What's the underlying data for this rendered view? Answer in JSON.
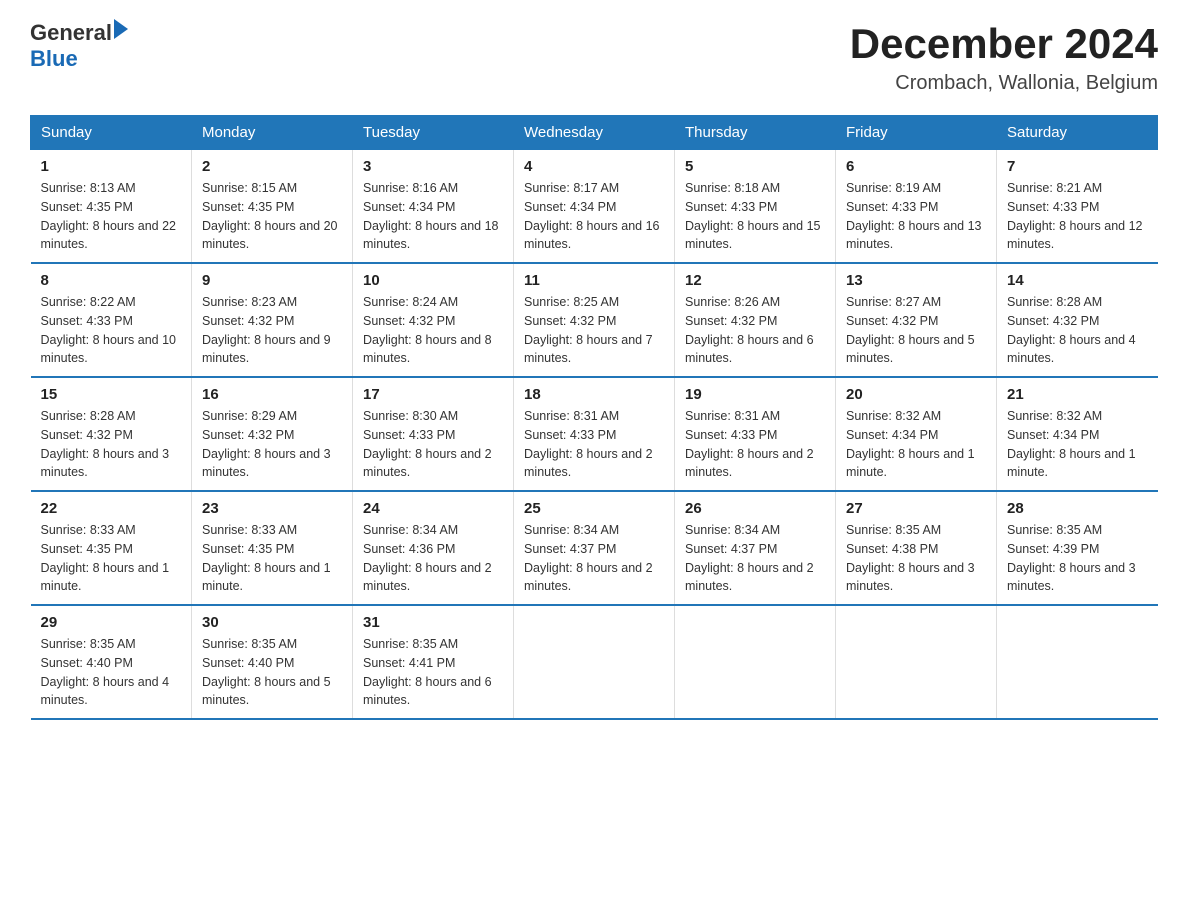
{
  "header": {
    "logo_general": "General",
    "logo_blue": "Blue",
    "title": "December 2024",
    "subtitle": "Crombach, Wallonia, Belgium"
  },
  "days_of_week": [
    "Sunday",
    "Monday",
    "Tuesday",
    "Wednesday",
    "Thursday",
    "Friday",
    "Saturday"
  ],
  "weeks": [
    [
      {
        "day": "1",
        "sunrise": "8:13 AM",
        "sunset": "4:35 PM",
        "daylight": "8 hours and 22 minutes."
      },
      {
        "day": "2",
        "sunrise": "8:15 AM",
        "sunset": "4:35 PM",
        "daylight": "8 hours and 20 minutes."
      },
      {
        "day": "3",
        "sunrise": "8:16 AM",
        "sunset": "4:34 PM",
        "daylight": "8 hours and 18 minutes."
      },
      {
        "day": "4",
        "sunrise": "8:17 AM",
        "sunset": "4:34 PM",
        "daylight": "8 hours and 16 minutes."
      },
      {
        "day": "5",
        "sunrise": "8:18 AM",
        "sunset": "4:33 PM",
        "daylight": "8 hours and 15 minutes."
      },
      {
        "day": "6",
        "sunrise": "8:19 AM",
        "sunset": "4:33 PM",
        "daylight": "8 hours and 13 minutes."
      },
      {
        "day": "7",
        "sunrise": "8:21 AM",
        "sunset": "4:33 PM",
        "daylight": "8 hours and 12 minutes."
      }
    ],
    [
      {
        "day": "8",
        "sunrise": "8:22 AM",
        "sunset": "4:33 PM",
        "daylight": "8 hours and 10 minutes."
      },
      {
        "day": "9",
        "sunrise": "8:23 AM",
        "sunset": "4:32 PM",
        "daylight": "8 hours and 9 minutes."
      },
      {
        "day": "10",
        "sunrise": "8:24 AM",
        "sunset": "4:32 PM",
        "daylight": "8 hours and 8 minutes."
      },
      {
        "day": "11",
        "sunrise": "8:25 AM",
        "sunset": "4:32 PM",
        "daylight": "8 hours and 7 minutes."
      },
      {
        "day": "12",
        "sunrise": "8:26 AM",
        "sunset": "4:32 PM",
        "daylight": "8 hours and 6 minutes."
      },
      {
        "day": "13",
        "sunrise": "8:27 AM",
        "sunset": "4:32 PM",
        "daylight": "8 hours and 5 minutes."
      },
      {
        "day": "14",
        "sunrise": "8:28 AM",
        "sunset": "4:32 PM",
        "daylight": "8 hours and 4 minutes."
      }
    ],
    [
      {
        "day": "15",
        "sunrise": "8:28 AM",
        "sunset": "4:32 PM",
        "daylight": "8 hours and 3 minutes."
      },
      {
        "day": "16",
        "sunrise": "8:29 AM",
        "sunset": "4:32 PM",
        "daylight": "8 hours and 3 minutes."
      },
      {
        "day": "17",
        "sunrise": "8:30 AM",
        "sunset": "4:33 PM",
        "daylight": "8 hours and 2 minutes."
      },
      {
        "day": "18",
        "sunrise": "8:31 AM",
        "sunset": "4:33 PM",
        "daylight": "8 hours and 2 minutes."
      },
      {
        "day": "19",
        "sunrise": "8:31 AM",
        "sunset": "4:33 PM",
        "daylight": "8 hours and 2 minutes."
      },
      {
        "day": "20",
        "sunrise": "8:32 AM",
        "sunset": "4:34 PM",
        "daylight": "8 hours and 1 minute."
      },
      {
        "day": "21",
        "sunrise": "8:32 AM",
        "sunset": "4:34 PM",
        "daylight": "8 hours and 1 minute."
      }
    ],
    [
      {
        "day": "22",
        "sunrise": "8:33 AM",
        "sunset": "4:35 PM",
        "daylight": "8 hours and 1 minute."
      },
      {
        "day": "23",
        "sunrise": "8:33 AM",
        "sunset": "4:35 PM",
        "daylight": "8 hours and 1 minute."
      },
      {
        "day": "24",
        "sunrise": "8:34 AM",
        "sunset": "4:36 PM",
        "daylight": "8 hours and 2 minutes."
      },
      {
        "day": "25",
        "sunrise": "8:34 AM",
        "sunset": "4:37 PM",
        "daylight": "8 hours and 2 minutes."
      },
      {
        "day": "26",
        "sunrise": "8:34 AM",
        "sunset": "4:37 PM",
        "daylight": "8 hours and 2 minutes."
      },
      {
        "day": "27",
        "sunrise": "8:35 AM",
        "sunset": "4:38 PM",
        "daylight": "8 hours and 3 minutes."
      },
      {
        "day": "28",
        "sunrise": "8:35 AM",
        "sunset": "4:39 PM",
        "daylight": "8 hours and 3 minutes."
      }
    ],
    [
      {
        "day": "29",
        "sunrise": "8:35 AM",
        "sunset": "4:40 PM",
        "daylight": "8 hours and 4 minutes."
      },
      {
        "day": "30",
        "sunrise": "8:35 AM",
        "sunset": "4:40 PM",
        "daylight": "8 hours and 5 minutes."
      },
      {
        "day": "31",
        "sunrise": "8:35 AM",
        "sunset": "4:41 PM",
        "daylight": "8 hours and 6 minutes."
      },
      null,
      null,
      null,
      null
    ]
  ],
  "labels": {
    "sunrise": "Sunrise:",
    "sunset": "Sunset:",
    "daylight": "Daylight:"
  }
}
